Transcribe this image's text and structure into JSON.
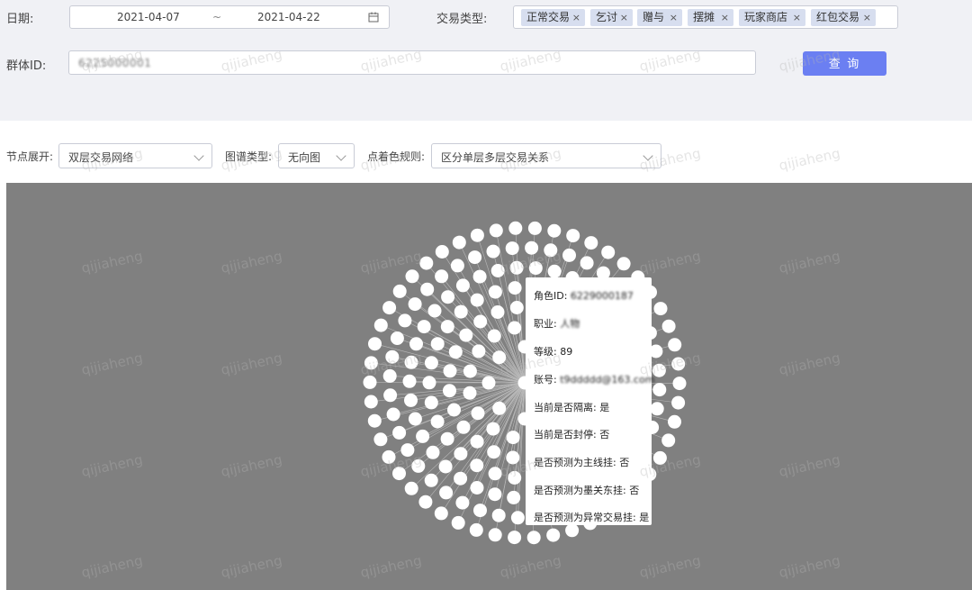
{
  "filters": {
    "date_label": "日期:",
    "date_start": "2021-04-07",
    "date_sep": "~",
    "date_end": "2021-04-22",
    "trade_type_label": "交易类型:",
    "trade_types": [
      "正常交易",
      "乞讨",
      "赠与",
      "摆摊",
      "玩家商店",
      "红包交易"
    ],
    "tag_remove": "×",
    "group_id_label": "群体ID:",
    "group_id_value": "6225000001",
    "query_button": "查 询"
  },
  "controls": {
    "expand_label": "节点展开:",
    "expand_value": "双层交易网络",
    "graph_type_label": "图谱类型:",
    "graph_type_value": "无向图",
    "color_rule_label": "点着色规则:",
    "color_rule_value": "区分单层多层交易关系"
  },
  "tooltip": {
    "role_id": "角色ID: 6229000187",
    "job": "职业: 人物",
    "level": "等级: 89",
    "account": "账号: t9ddddd@163.com",
    "isolated": "当前是否隔离: 是",
    "banned": "当前是否封停: 否",
    "main_bot": "是否预测为主线挂: 否",
    "dungeon_bot": "是否预测为墨关东挂: 否",
    "trade_bot": "是否预测为异常交易挂: 是"
  },
  "watermark": "qijiaheng",
  "colors": {
    "panel_bg": "#f0f1f5",
    "graph_bg": "#808080",
    "node_fill": "#ffffff",
    "primary_button": "#6b7ff2",
    "tag_bg": "#d7deef"
  }
}
